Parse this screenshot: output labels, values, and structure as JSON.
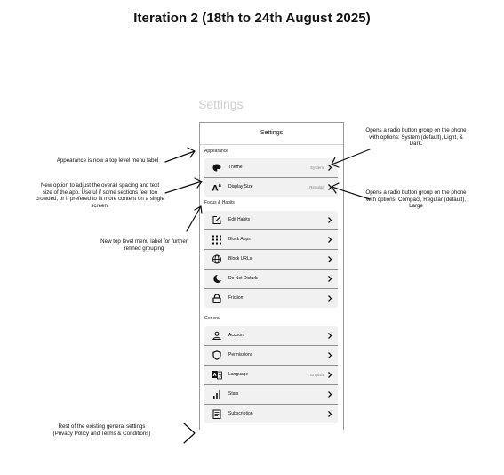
{
  "heading": "Iteration 2 (18th to 24th August 2025)",
  "ghost_title": "Settings",
  "phone": {
    "title": "Settings",
    "sections": {
      "appearance": {
        "label": "Appearance",
        "items": [
          {
            "label": "Theme",
            "value": "System",
            "icon": "palette-icon"
          },
          {
            "label": "Display Size",
            "value": "Regular",
            "icon": "font-size-icon"
          }
        ]
      },
      "focus": {
        "label": "Focus & Habits",
        "items": [
          {
            "label": "Edit Habits",
            "icon": "edit-icon"
          },
          {
            "label": "Block Apps",
            "icon": "grid-icon"
          },
          {
            "label": "Block URLs",
            "icon": "globe-icon"
          },
          {
            "label": "Do Not Disturb",
            "icon": "moon-icon"
          },
          {
            "label": "Friction",
            "icon": "lock-icon"
          }
        ]
      },
      "general": {
        "label": "General",
        "items": [
          {
            "label": "Account",
            "icon": "person-icon"
          },
          {
            "label": "Permissions",
            "icon": "shield-icon"
          },
          {
            "label": "Language",
            "value": "English",
            "icon": "translate-icon"
          },
          {
            "label": "Stats",
            "icon": "bar-chart-icon"
          },
          {
            "label": "Subscription",
            "icon": "receipt-icon"
          }
        ]
      }
    }
  },
  "annotations": {
    "appearance": "Appearance is now a top level menu label",
    "display_size": "New option to adjust the overall spacing and text size of the app. Useful if some sections feel too crowded, or if prefered to fit more content on a single screen.",
    "focus_label": "New top level menu label for further refined grouping",
    "rest": "Rest of the existing general settings (Privacy Policy and Terms & Conditions)",
    "theme": "Opens a radio button group on the phone with options: System (default), Light, & Dark.",
    "display_options": "Opens a radio button group on the phone with options: Compact, Regular (default), Large"
  }
}
